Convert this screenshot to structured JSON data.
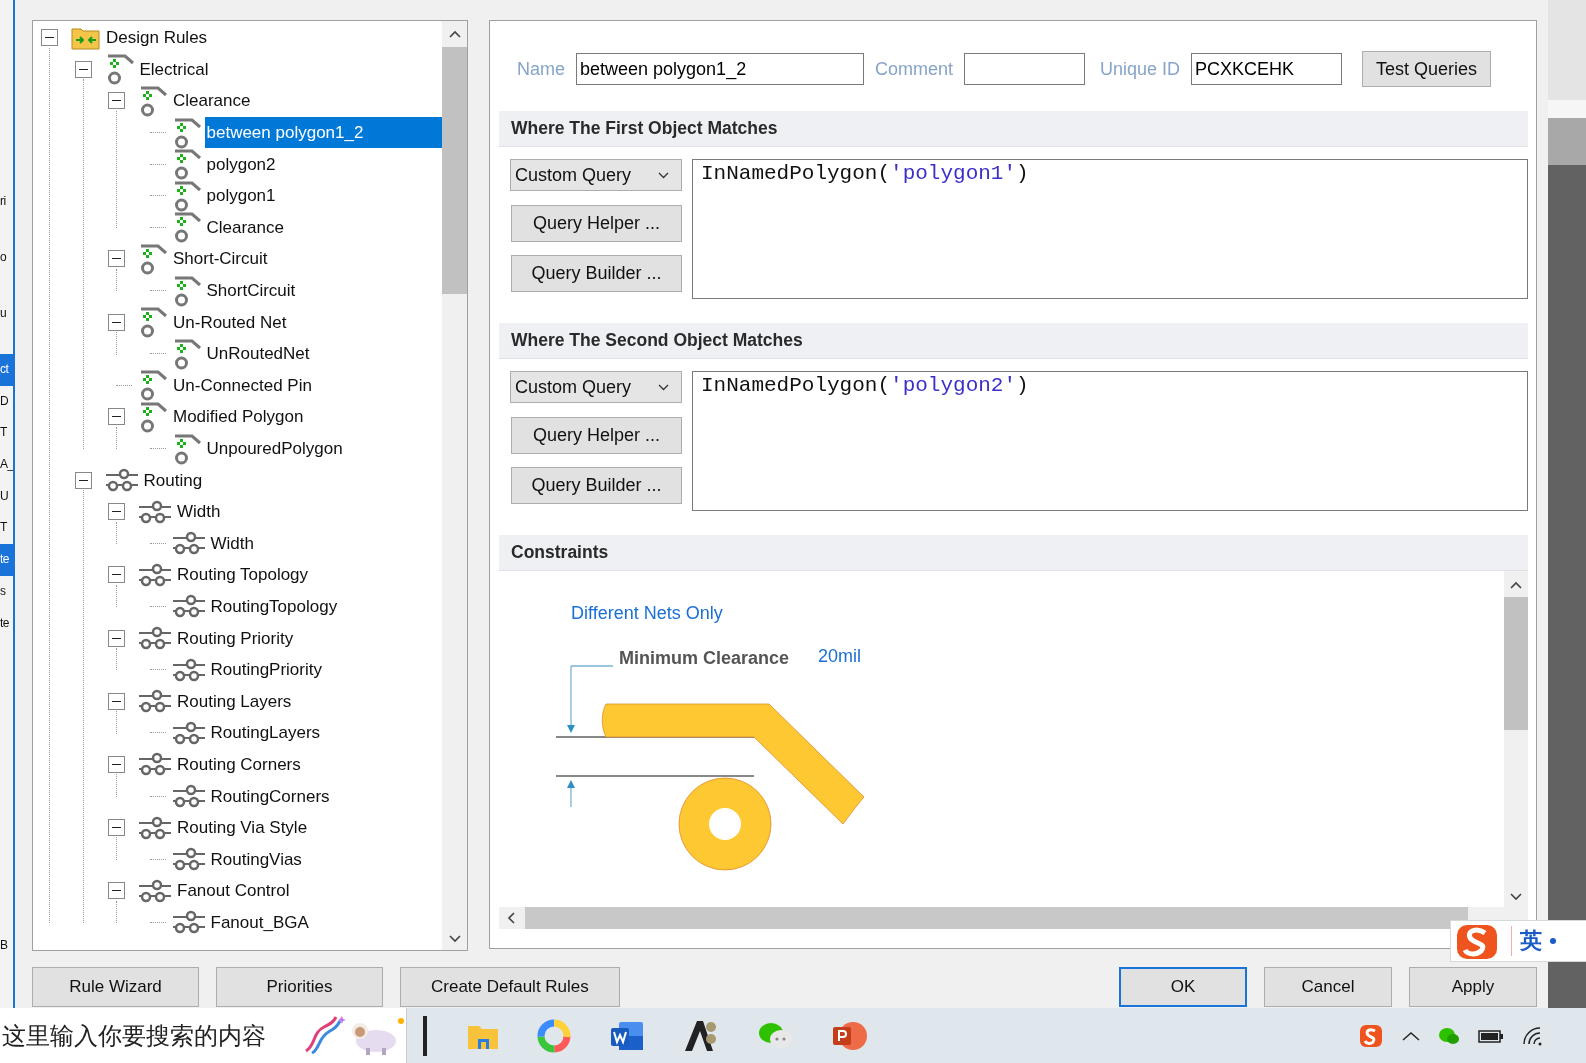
{
  "background_window": {
    "fragments": [
      {
        "text": "ri",
        "selected": false
      },
      {
        "text": "o",
        "selected": false
      },
      {
        "text": "u",
        "selected": false
      },
      {
        "text": "ct",
        "selected": true
      },
      {
        "text": "D",
        "selected": false
      },
      {
        "text": "T",
        "selected": false
      },
      {
        "text": "A_",
        "selected": false
      },
      {
        "text": "U",
        "selected": false
      },
      {
        "text": "T",
        "selected": false
      },
      {
        "text": "te",
        "selected": true
      },
      {
        "text": "s",
        "selected": false
      },
      {
        "text": "te",
        "selected": false
      },
      {
        "text": "B",
        "selected": false
      }
    ]
  },
  "dialog": {
    "rule_tree": [
      {
        "label": "Design Rules",
        "kind": "folder",
        "expanded": true,
        "selected": false,
        "children": [
          {
            "label": "Electrical",
            "kind": "electrical",
            "expanded": true,
            "selected": false,
            "children": [
              {
                "label": "Clearance",
                "kind": "electrical",
                "expanded": true,
                "selected": false,
                "children": [
                  {
                    "label": "between polygon1_2",
                    "kind": "electrical",
                    "selected": true
                  },
                  {
                    "label": "polygon2",
                    "kind": "electrical",
                    "selected": false
                  },
                  {
                    "label": "polygon1",
                    "kind": "electrical",
                    "selected": false
                  },
                  {
                    "label": "Clearance",
                    "kind": "electrical",
                    "selected": false
                  }
                ]
              },
              {
                "label": "Short-Circuit",
                "kind": "electrical",
                "expanded": true,
                "selected": false,
                "children": [
                  {
                    "label": "ShortCircuit",
                    "kind": "electrical",
                    "selected": false
                  }
                ]
              },
              {
                "label": "Un-Routed Net",
                "kind": "electrical",
                "expanded": true,
                "selected": false,
                "children": [
                  {
                    "label": "UnRoutedNet",
                    "kind": "electrical",
                    "selected": false
                  }
                ]
              },
              {
                "label": "Un-Connected Pin",
                "kind": "electrical",
                "selected": false
              },
              {
                "label": "Modified Polygon",
                "kind": "electrical",
                "expanded": true,
                "selected": false,
                "children": [
                  {
                    "label": "UnpouredPolygon",
                    "kind": "electrical",
                    "selected": false
                  }
                ]
              }
            ]
          },
          {
            "label": "Routing",
            "kind": "routing",
            "expanded": true,
            "selected": false,
            "children": [
              {
                "label": "Width",
                "kind": "routing",
                "expanded": true,
                "selected": false,
                "children": [
                  {
                    "label": "Width",
                    "kind": "routing",
                    "selected": false
                  }
                ]
              },
              {
                "label": "Routing Topology",
                "kind": "routing",
                "expanded": true,
                "selected": false,
                "children": [
                  {
                    "label": "RoutingTopology",
                    "kind": "routing",
                    "selected": false
                  }
                ]
              },
              {
                "label": "Routing Priority",
                "kind": "routing",
                "expanded": true,
                "selected": false,
                "children": [
                  {
                    "label": "RoutingPriority",
                    "kind": "routing",
                    "selected": false
                  }
                ]
              },
              {
                "label": "Routing Layers",
                "kind": "routing",
                "expanded": true,
                "selected": false,
                "children": [
                  {
                    "label": "RoutingLayers",
                    "kind": "routing",
                    "selected": false
                  }
                ]
              },
              {
                "label": "Routing Corners",
                "kind": "routing",
                "expanded": true,
                "selected": false,
                "children": [
                  {
                    "label": "RoutingCorners",
                    "kind": "routing",
                    "selected": false
                  }
                ]
              },
              {
                "label": "Routing Via Style",
                "kind": "routing",
                "expanded": true,
                "selected": false,
                "children": [
                  {
                    "label": "RoutingVias",
                    "kind": "routing",
                    "selected": false
                  }
                ]
              },
              {
                "label": "Fanout Control",
                "kind": "routing",
                "expanded": true,
                "selected": false,
                "children": [
                  {
                    "label": "Fanout_BGA",
                    "kind": "routing",
                    "selected": false
                  }
                ]
              }
            ]
          }
        ]
      }
    ],
    "rule_editor": {
      "name_label": "Name",
      "name": "between polygon1_2",
      "comment_label": "Comment",
      "unique_id_label": "Unique ID",
      "unique_id": "PCXKCEHK",
      "test_button": "Test Queries",
      "object_matches": [
        {
          "heading": "Where The First Object Matches",
          "query_type": "Custom Query",
          "helper_button": "Query Helper ...",
          "builder_button": "Query Builder ...",
          "query": [
            {
              "kind": "plain",
              "text": "InNamedPolygon("
            },
            {
              "kind": "string",
              "text": "'polygon1'"
            },
            {
              "kind": "plain",
              "text": ")"
            }
          ]
        },
        {
          "heading": "Where The Second Object Matches",
          "query_type": "Custom Query",
          "helper_button": "Query Helper ...",
          "builder_button": "Query Builder ...",
          "query": [
            {
              "kind": "plain",
              "text": "InNamedPolygon("
            },
            {
              "kind": "string",
              "text": "'polygon2'"
            },
            {
              "kind": "plain",
              "text": ")"
            }
          ]
        }
      ],
      "constraints": {
        "heading": "Constraints",
        "net_scope": "Different Nets Only",
        "clearance_label": "Minimum Clearance",
        "clearance_value": "20mil"
      }
    },
    "buttons_left": [
      "Rule Wizard",
      "Priorities",
      "Create Default Rules"
    ],
    "buttons_right": [
      {
        "label": "OK",
        "default": true
      },
      {
        "label": "Cancel",
        "default": false
      },
      {
        "label": "Apply",
        "default": false
      }
    ]
  },
  "ime_bar": {
    "mode": "英"
  },
  "taskbar": {
    "search_placeholder": "这里输入你要搜索的内容"
  }
}
